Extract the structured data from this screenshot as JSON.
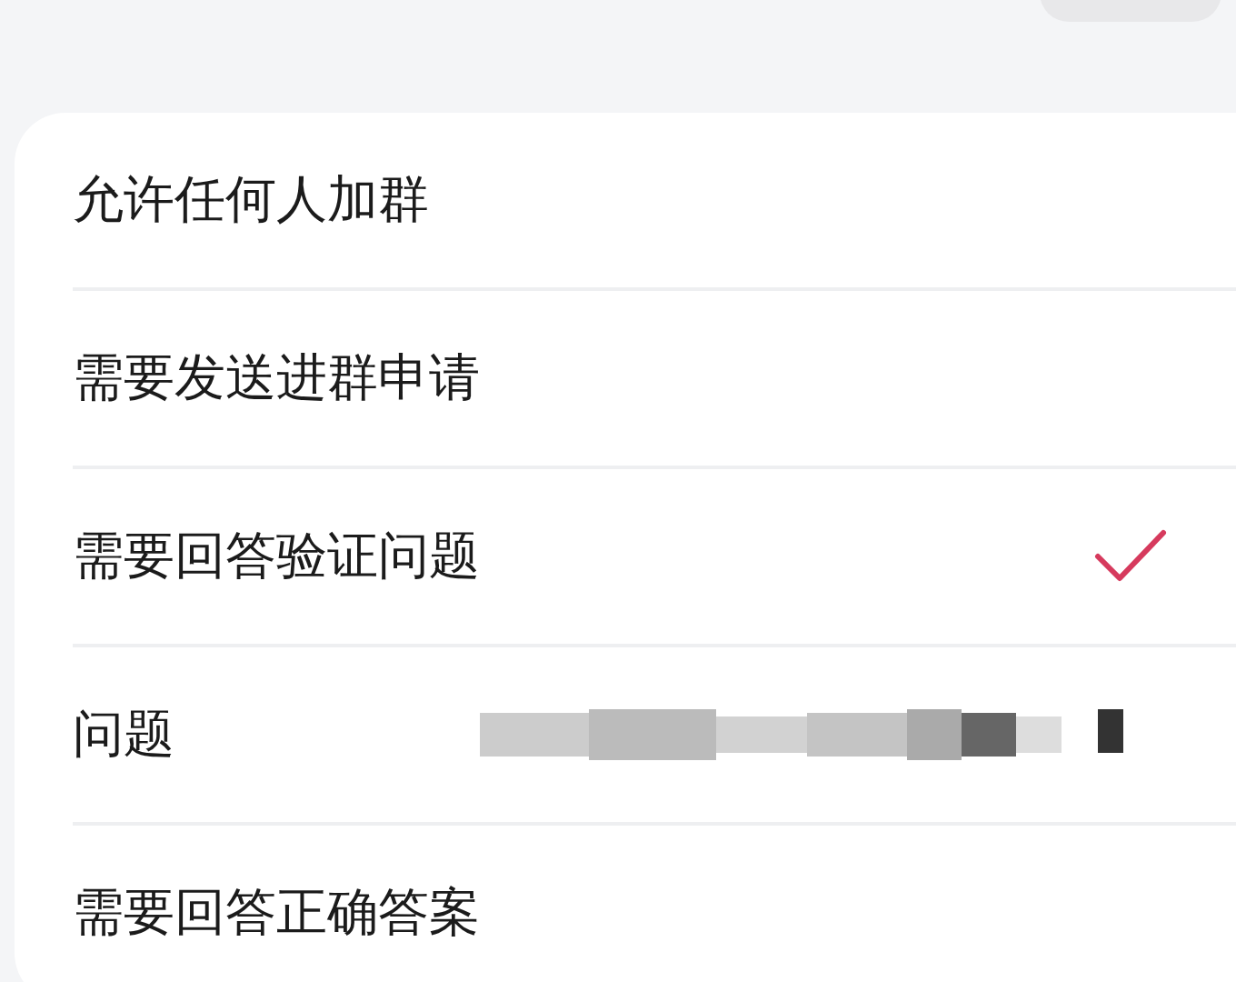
{
  "rows": [
    {
      "kind": "option",
      "label": "允许任何人加群",
      "checked": false
    },
    {
      "kind": "option",
      "label": "需要发送进群申请",
      "checked": false
    },
    {
      "kind": "option",
      "label": "需要回答验证问题",
      "checked": true
    },
    {
      "kind": "field",
      "label": "问题"
    },
    {
      "kind": "option",
      "label": "需要回答正确答案",
      "checked": false
    }
  ]
}
